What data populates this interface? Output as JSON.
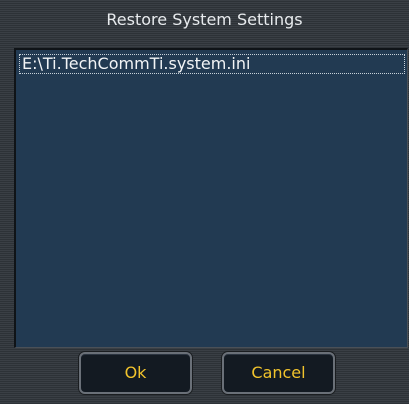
{
  "dialog": {
    "title": "Restore System Settings"
  },
  "file_list": {
    "items": [
      {
        "label": "E:\\Ti.TechCommTi.system.ini"
      }
    ]
  },
  "buttons": {
    "ok_label": "Ok",
    "cancel_label": "Cancel"
  },
  "colors": {
    "background": "#34393f",
    "listbox_background": "#223a52",
    "button_background": "#131a22",
    "button_text": "#f1c32c",
    "title_text": "#e8ebee"
  }
}
